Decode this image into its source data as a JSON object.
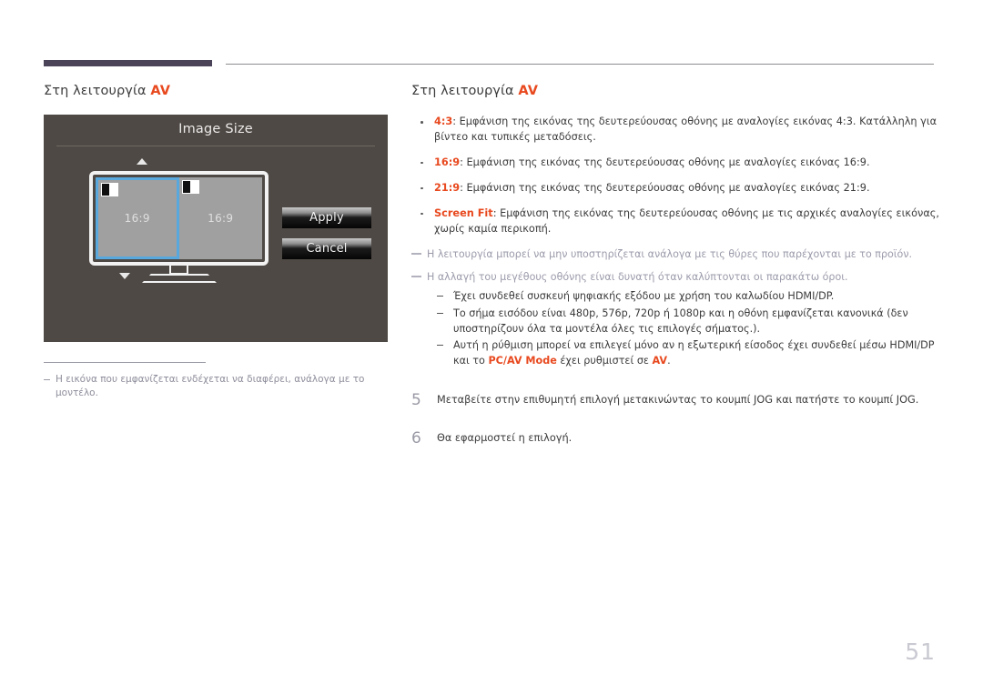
{
  "page": {
    "number": "51"
  },
  "left": {
    "title_prefix": "Στη λειτουργία ",
    "title_accent": "AV",
    "osd": {
      "title": "Image Size",
      "pane_left_label": "16:9",
      "pane_right_label": "16:9",
      "apply_label": "Apply",
      "cancel_label": "Cancel",
      "arrow_up": "triangle-up-icon",
      "arrow_down": "triangle-down-icon"
    },
    "note": "Η εικόνα που εμφανίζεται ενδέχεται να διαφέρει, ανάλογα με το μοντέλο."
  },
  "right": {
    "title_prefix": "Στη λειτουργία ",
    "title_accent": "AV",
    "bullets": [
      {
        "term": "4:3",
        "text": ": Εμφάνιση της εικόνας της δευτερεύουσας οθόνης με αναλογίες εικόνας 4:3. Κατάλληλη για βίντεο και τυπικές μεταδόσεις."
      },
      {
        "term": "16:9",
        "text": ": Εμφάνιση της εικόνας της δευτερεύουσας οθόνης με αναλογίες εικόνας 16:9."
      },
      {
        "term": "21:9",
        "text": ": Εμφάνιση της εικόνας της δευτερεύουσας οθόνης με αναλογίες εικόνας 21:9."
      },
      {
        "term": "Screen Fit",
        "text": ": Εμφάνιση της εικόνας της δευτερεύουσας οθόνης με τις αρχικές αναλογίες εικόνας, χωρίς καμία περικοπή."
      }
    ],
    "note_1": "Η λειτουργία μπορεί να μην υποστηρίζεται ανάλογα με τις θύρες που παρέχονται με το προϊόν.",
    "note_2": "Η αλλαγή του μεγέθους οθόνης είναι δυνατή όταν καλύπτονται οι παρακάτω όροι.",
    "subitems": [
      {
        "text": "Έχει συνδεθεί συσκευή ψηφιακής εξόδου με χρήση του καλωδίου HDMI/DP."
      },
      {
        "text": "Το σήμα εισόδου είναι 480p, 576p, 720p ή 1080p και η οθόνη εμφανίζεται κανονικά (δεν υποστηρίζουν όλα τα μοντέλα όλες τις επιλογές σήματος.)."
      }
    ],
    "subitem_last": {
      "text_before": "Αυτή η ρύθμιση μπορεί να επιλεγεί μόνο αν η εξωτερική είσοδος έχει συνδεθεί μέσω HDMI/DP και το ",
      "term_1": "PC/AV Mode",
      "text_middle": " έχει ρυθμιστεί σε ",
      "term_2": "AV",
      "text_after": "."
    },
    "steps": [
      {
        "num": "5",
        "text": "Μεταβείτε στην επιθυμητή επιλογή μετακινώντας το κουμπί JOG και πατήστε το κουμπί JOG."
      },
      {
        "num": "6",
        "text": "Θα εφαρμοστεί η επιλογή."
      }
    ]
  },
  "colors": {
    "accent": "#e8491f",
    "header_bar": "#4b4459",
    "osd_bg": "#4e4944",
    "selection_blue": "#58a7dd",
    "note_gray": "#9b9bab"
  }
}
